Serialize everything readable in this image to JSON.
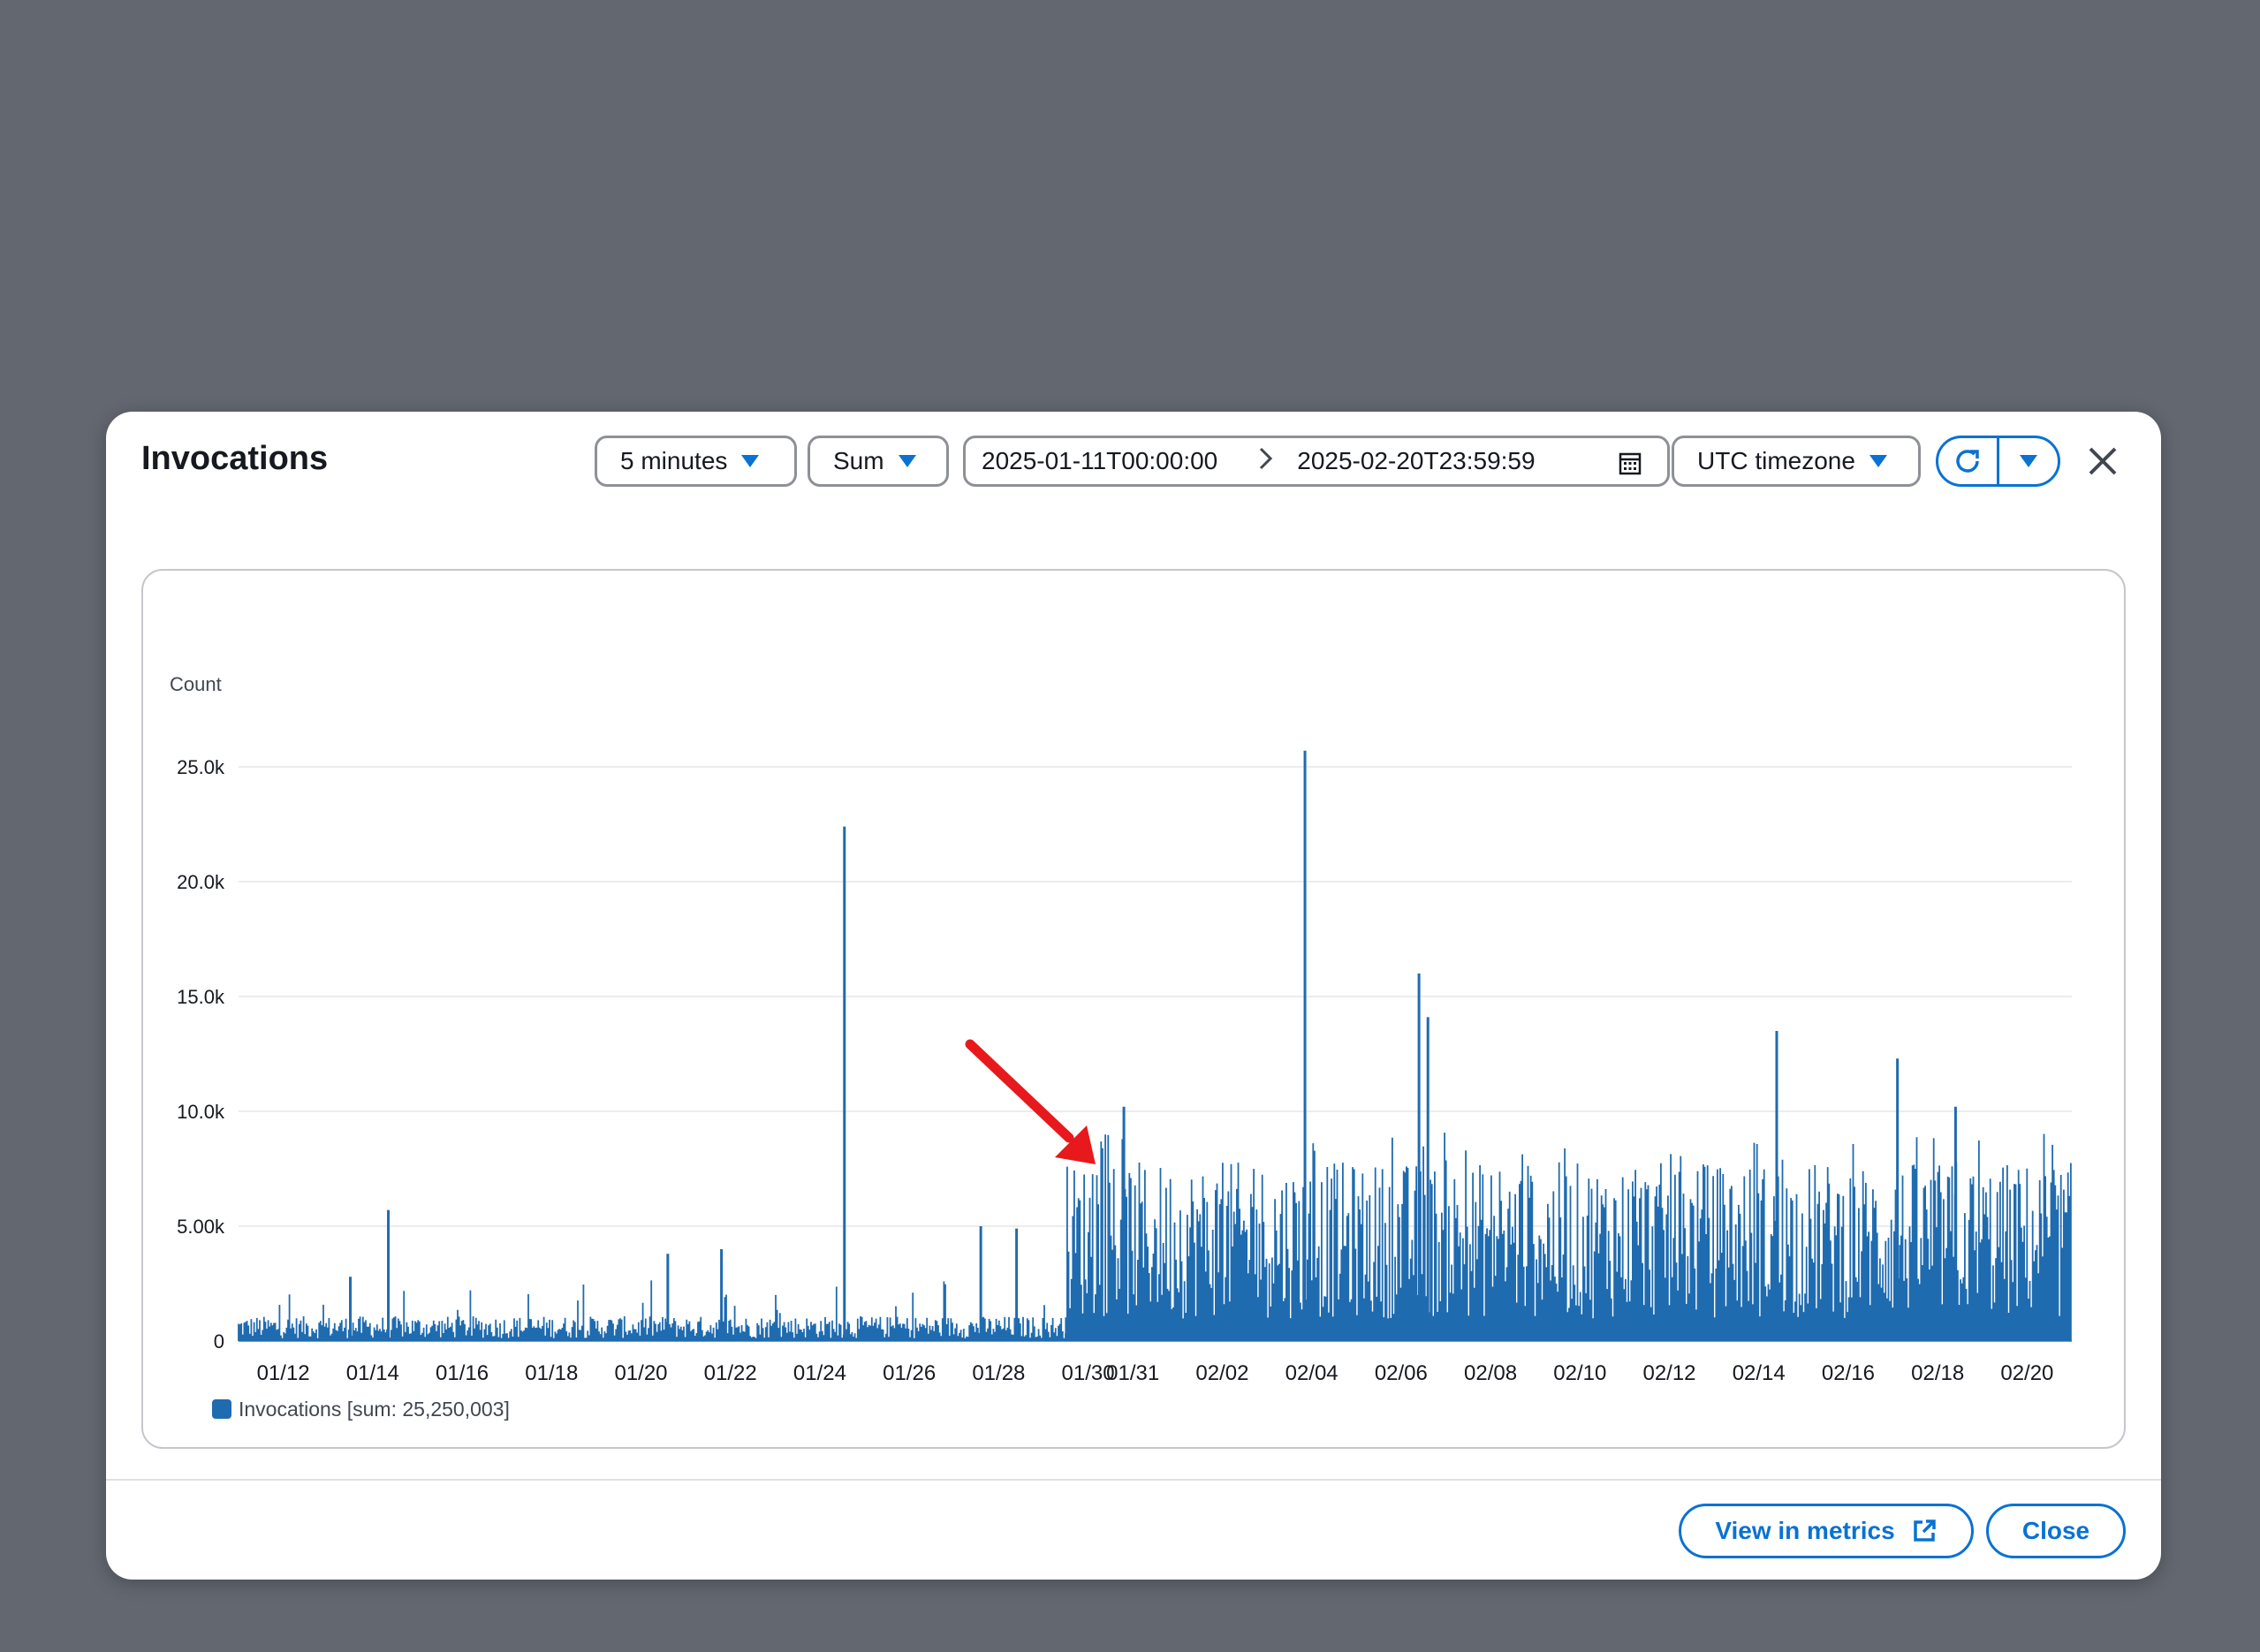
{
  "modal": {
    "title": "Invocations",
    "period": "5 minutes",
    "statistic": "Sum",
    "range_start": "2025-01-11T00:00:00",
    "range_end": "2025-02-20T23:59:59",
    "timezone": "UTC timezone",
    "view_metrics_label": "View in metrics",
    "close_label": "Close"
  },
  "icons": {
    "period_caret": "caret-down-icon",
    "stat_caret": "caret-down-icon",
    "range_separator": "chevron-right-icon",
    "calendar": "calendar-icon",
    "tz_caret": "caret-down-icon",
    "refresh": "refresh-icon",
    "refresh_menu": "caret-down-icon",
    "close": "close-icon",
    "external": "external-link-icon",
    "annotation": "red-arrow-annotation"
  },
  "colors": {
    "series": "#1f6bb0",
    "accent": "#0972d3",
    "annotation": "#e8191c"
  },
  "chart_data": {
    "type": "bar",
    "ylabel": "Count",
    "ylim": [
      0,
      27000
    ],
    "y_ticks": [
      "0",
      "5.00k",
      "10.0k",
      "15.0k",
      "20.0k",
      "25.0k"
    ],
    "y_tick_values": [
      0,
      5000,
      10000,
      15000,
      20000,
      25000
    ],
    "x_tick_labels": [
      "01/12",
      "01/14",
      "01/16",
      "01/18",
      "01/20",
      "01/22",
      "01/24",
      "01/26",
      "01/28",
      "01/30",
      "01/31",
      "02/02",
      "02/04",
      "02/06",
      "02/08",
      "02/10",
      "02/12",
      "02/14",
      "02/16",
      "02/18",
      "02/20"
    ],
    "x_tick_days": [
      1,
      3,
      5,
      7,
      9,
      11,
      13,
      15,
      17,
      19,
      20,
      22,
      24,
      26,
      28,
      30,
      32,
      34,
      36,
      38,
      40
    ],
    "x_range_days": [
      0,
      41
    ],
    "legend": "Invocations [sum: 25,250,003]",
    "legend_placement": "bottom-left",
    "grid": true,
    "series": [
      {
        "name": "Invocations",
        "baseline": [
          {
            "from_day": 0,
            "to_day": 18.5,
            "level": 600
          },
          {
            "from_day": 18.5,
            "to_day": 41,
            "level": 6500
          }
        ],
        "spikes": [
          {
            "day": 3.35,
            "value": 5700
          },
          {
            "day": 2.5,
            "value": 2800
          },
          {
            "day": 9.6,
            "value": 3800
          },
          {
            "day": 10.8,
            "value": 4000
          },
          {
            "day": 13.55,
            "value": 22400
          },
          {
            "day": 16.6,
            "value": 5000
          },
          {
            "day": 17.4,
            "value": 4900
          },
          {
            "day": 19.8,
            "value": 10200
          },
          {
            "day": 23.85,
            "value": 25700
          },
          {
            "day": 26.4,
            "value": 16000
          },
          {
            "day": 26.6,
            "value": 14100
          },
          {
            "day": 34.4,
            "value": 13500
          },
          {
            "day": 37.1,
            "value": 12300
          },
          {
            "day": 38.4,
            "value": 10200
          }
        ]
      }
    ]
  }
}
